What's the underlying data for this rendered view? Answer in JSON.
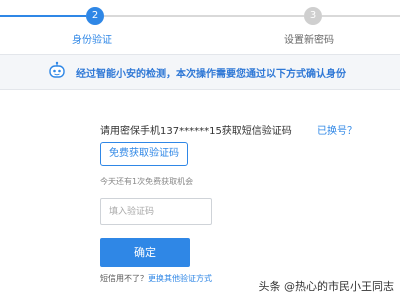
{
  "steps": [
    {
      "number": "2",
      "label": "身份验证",
      "state": "active"
    },
    {
      "number": "3",
      "label": "设置新密码",
      "state": "inactive"
    }
  ],
  "notice": {
    "icon": "robot-icon",
    "text": "经过智能小安的检测，本次操作需要您通过以下方式确认身份"
  },
  "verify": {
    "phone_prompt": "请用密保手机137******15获取短信验证码",
    "change_link": "已换号？",
    "get_code_label": "免费获取验证码",
    "hint": "今天还有1次免费获取机会",
    "code_placeholder": "填入验证码",
    "code_value": "",
    "confirm_label": "确定",
    "sms_question": "短信用不了？",
    "other_method_link": "更换其他验证方式"
  },
  "watermark": "头条 @热心的市民小王同志",
  "colors": {
    "accent": "#2f87e6",
    "inactive": "#cfcfcf",
    "notice_bg": "#f4f6f9"
  }
}
